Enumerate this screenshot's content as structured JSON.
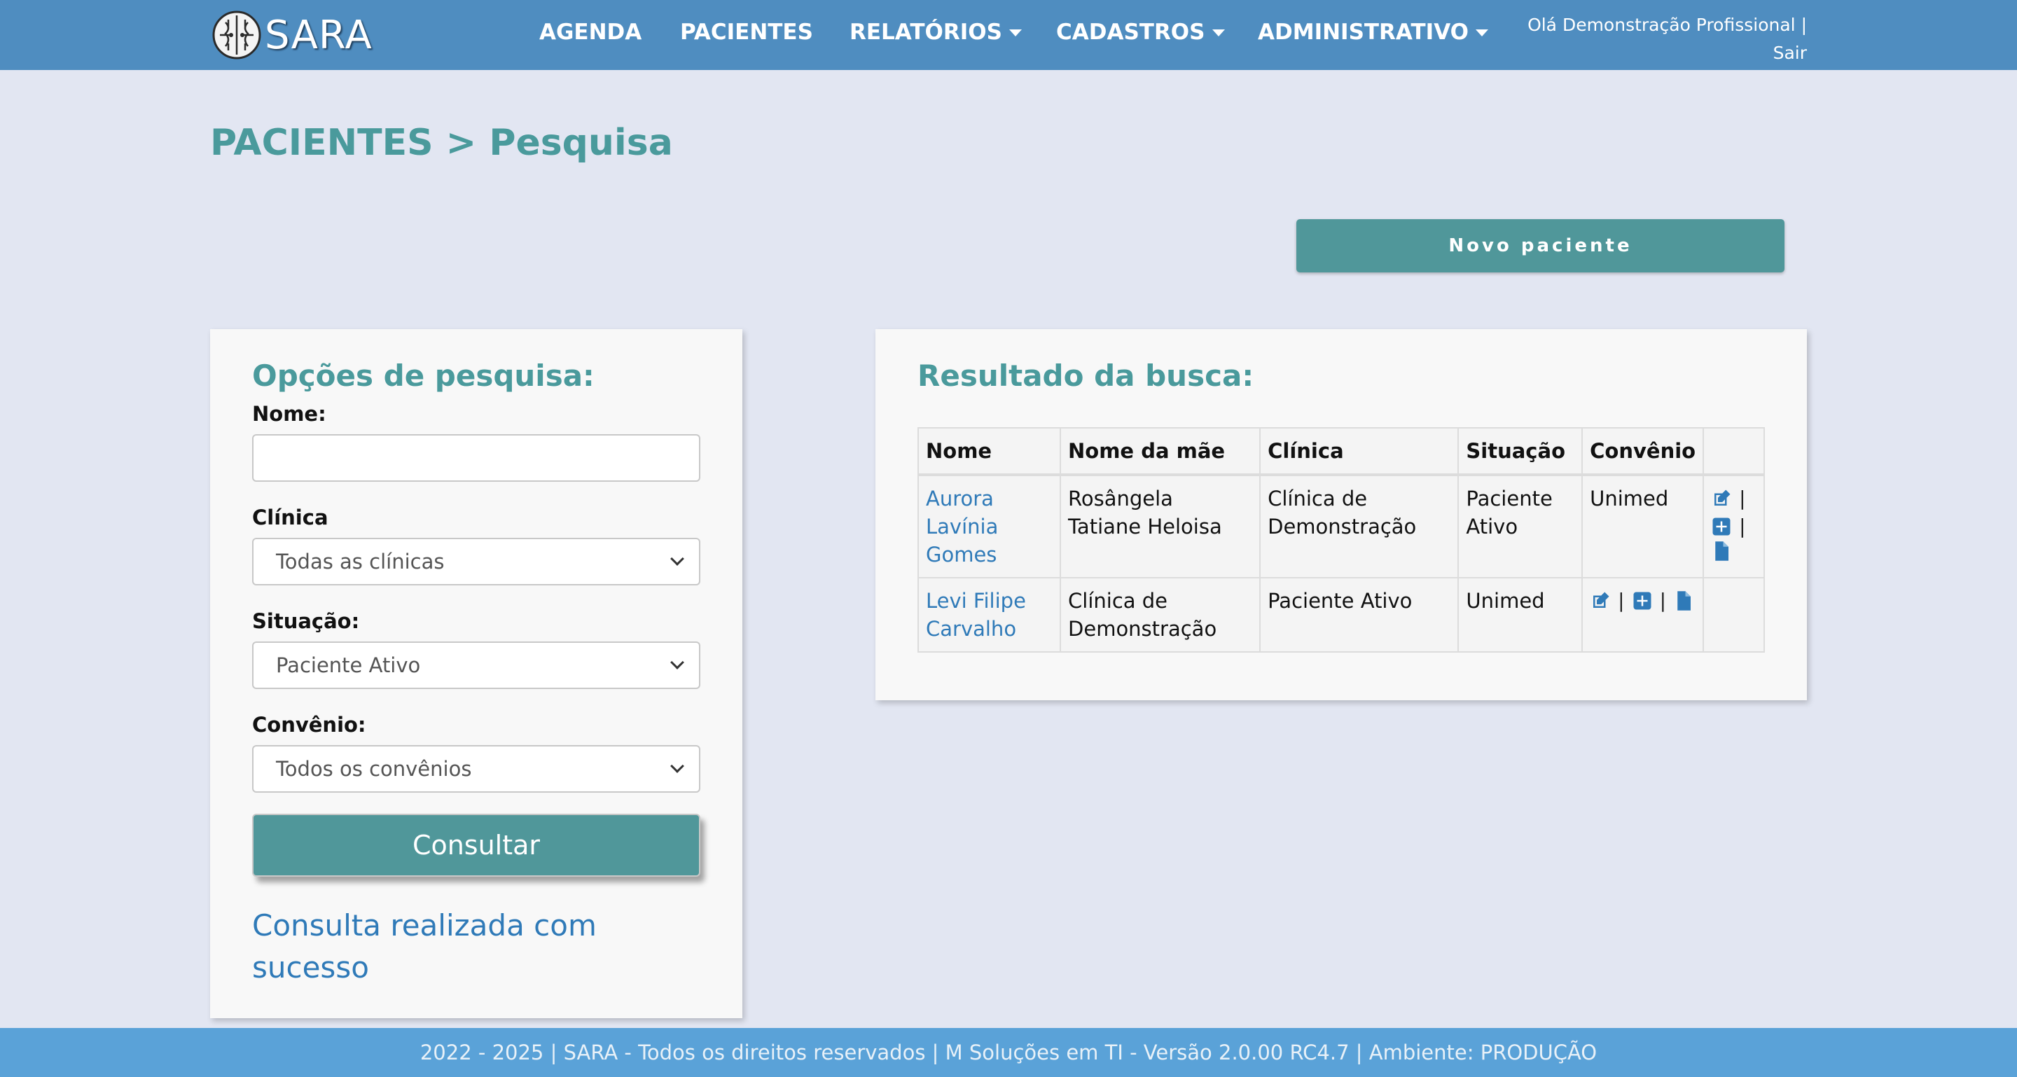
{
  "brand": {
    "name": "SARA"
  },
  "nav": {
    "items": [
      {
        "label": "AGENDA",
        "dropdown": false
      },
      {
        "label": "PACIENTES",
        "dropdown": false
      },
      {
        "label": "RELATÓRIOS",
        "dropdown": true
      },
      {
        "label": "CADASTROS",
        "dropdown": true
      },
      {
        "label": "ADMINISTRATIVO",
        "dropdown": true
      }
    ],
    "user_greeting": "Olá Demonstração Profissional |",
    "logout_label": "Sair"
  },
  "page": {
    "title": "PACIENTES > Pesquisa",
    "new_patient_label": "Novo paciente"
  },
  "search": {
    "heading": "Opções de pesquisa:",
    "name_label": "Nome:",
    "name_value": "",
    "clinic_label": "Clínica",
    "clinic_value": "Todas as clínicas",
    "status_label": "Situação:",
    "status_value": "Paciente Ativo",
    "insurance_label": "Convênio:",
    "insurance_value": "Todos os convênios",
    "submit_label": "Consultar",
    "result_message": "Consulta realizada com sucesso"
  },
  "results": {
    "heading": "Resultado da busca:",
    "columns": [
      "Nome",
      "Nome da mãe",
      "Clínica",
      "Situação",
      "Convênio",
      ""
    ],
    "rows": [
      {
        "name": "Aurora Lavínia Gomes",
        "mother": "Rosângela Tatiane Heloisa",
        "clinic": "Clínica de Demonstração",
        "status": "Paciente Ativo",
        "insurance": "Unimed"
      },
      {
        "name": "Levi Filipe Carvalho",
        "mother": "Clínica de Demonstração",
        "clinic": "Paciente Ativo",
        "status": "Unimed",
        "insurance": ""
      }
    ],
    "separator": "|"
  },
  "footer": {
    "text": "2022 - 2025 | SARA - Todos os direitos reservados | M Soluções em TI - Versão 2.0.00 RC4.7 | Ambiente: PRODUÇÃO"
  },
  "colors": {
    "navbar": "#4f8dc0",
    "accent": "#4a9a9c",
    "button": "#50979a",
    "link": "#2f7ab8",
    "footer": "#5aa2d8",
    "background": "#e2e6f2"
  },
  "icons": [
    "brain-logo-icon",
    "caret-down-icon",
    "edit-icon",
    "plus-square-icon",
    "file-icon",
    "chevron-down-icon"
  ]
}
